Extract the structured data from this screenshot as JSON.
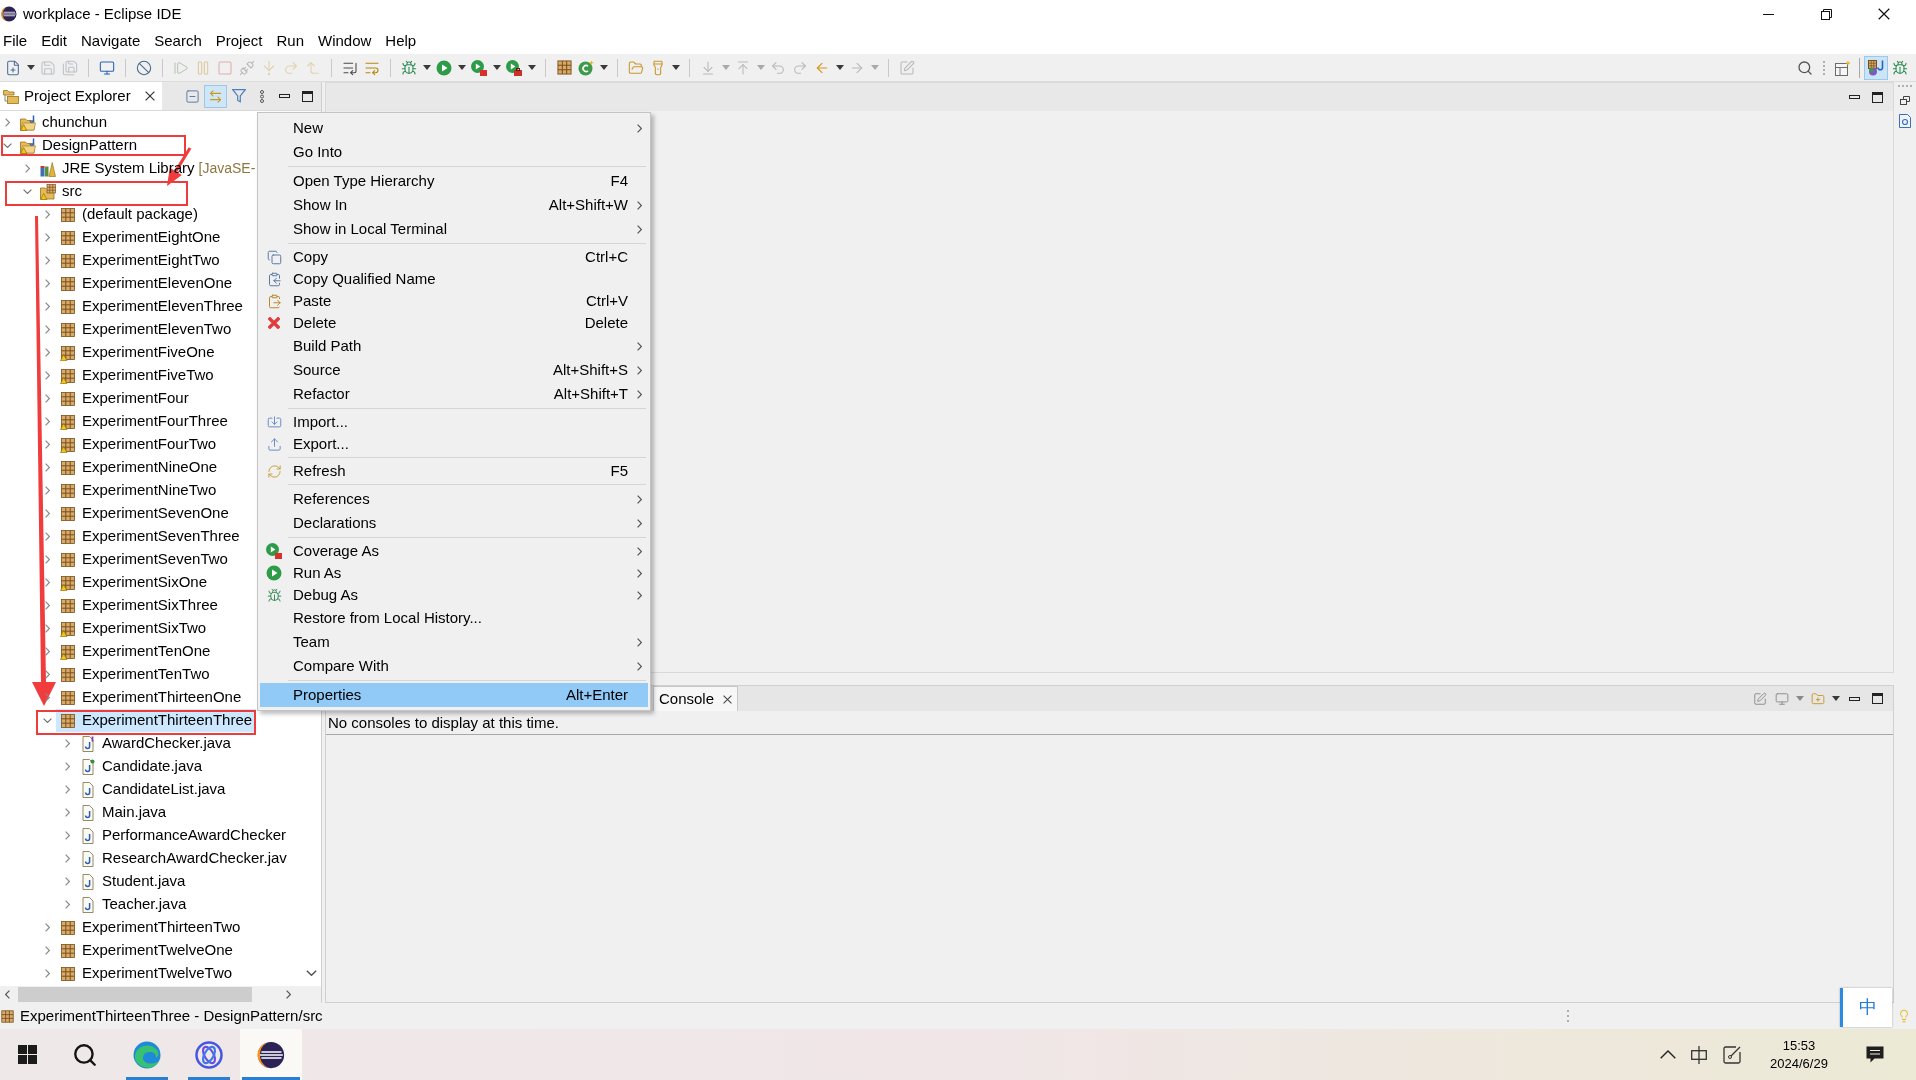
{
  "window": {
    "title": "workplace - Eclipse IDE"
  },
  "menu_bar": [
    "File",
    "Edit",
    "Navigate",
    "Search",
    "Project",
    "Run",
    "Window",
    "Help"
  ],
  "toolbar": [
    [
      {
        "dropdown": true,
        "disabled": false
      },
      {
        "dropdown": false,
        "disabled": true
      },
      {
        "dropdown": false,
        "disabled": true
      }
    ],
    [
      {
        "dropdown": false,
        "disabled": false
      }
    ],
    [
      {
        "dropdown": false,
        "disabled": false
      }
    ],
    [
      {
        "dropdown": false,
        "disabled": true
      },
      {
        "dropdown": false,
        "disabled": true
      },
      {
        "dropdown": false,
        "disabled": true
      },
      {
        "dropdown": false,
        "disabled": true
      },
      {
        "dropdown": false,
        "disabled": true
      },
      {
        "dropdown": false,
        "disabled": true
      },
      {
        "dropdown": false,
        "disabled": true
      }
    ],
    [
      {
        "dropdown": false,
        "disabled": false
      },
      {
        "dropdown": false,
        "disabled": false
      }
    ],
    [
      {
        "dropdown": true,
        "disabled": false
      },
      {
        "dropdown": true,
        "disabled": false
      },
      {
        "dropdown": true,
        "disabled": false
      },
      {
        "dropdown": true,
        "disabled": false
      }
    ],
    [
      {
        "dropdown": false,
        "disabled": false
      },
      {
        "dropdown": true,
        "disabled": false
      }
    ],
    [
      {
        "dropdown": false,
        "disabled": false
      },
      {
        "dropdown": true,
        "disabled": false
      }
    ],
    [
      {
        "dropdown": true,
        "disabled": true
      },
      {
        "dropdown": true,
        "disabled": true
      },
      {
        "dropdown": false,
        "disabled": true
      },
      {
        "dropdown": false,
        "disabled": true
      },
      {
        "dropdown": true,
        "disabled": false
      },
      {
        "dropdown": true,
        "disabled": true
      }
    ],
    [
      {
        "dropdown": false,
        "disabled": true
      }
    ]
  ],
  "perspectives": [
    {
      "selected": true
    },
    {
      "selected": false
    }
  ],
  "project_explorer": {
    "title": "Project Explorer",
    "tools": [
      {
        "on": false
      },
      {
        "on": true
      },
      {
        "on": false
      }
    ],
    "tree": [
      {
        "label": "chunchun",
        "kind": "project",
        "warning": true,
        "expanded": false,
        "selected": false
      },
      {
        "label": "DesignPattern",
        "kind": "project",
        "warning": true,
        "expanded": true,
        "selected": false,
        "children": [
          {
            "label": "JRE System Library",
            "decoration": "[JavaSE-",
            "kind": "library",
            "warning": false,
            "expanded": false,
            "selected": false
          },
          {
            "label": "src",
            "kind": "source",
            "warning": true,
            "expanded": true,
            "selected": false,
            "children": [
              {
                "label": "(default package)",
                "kind": "package",
                "warning": false,
                "expanded": false,
                "selected": false
              },
              {
                "label": "ExperimentEightOne",
                "kind": "package",
                "warning": false,
                "expanded": false,
                "selected": false
              },
              {
                "label": "ExperimentEightTwo",
                "kind": "package",
                "warning": false,
                "expanded": false,
                "selected": false
              },
              {
                "label": "ExperimentElevenOne",
                "kind": "package",
                "warning": false,
                "expanded": false,
                "selected": false
              },
              {
                "label": "ExperimentElevenThree",
                "kind": "package",
                "warning": false,
                "expanded": false,
                "selected": false
              },
              {
                "label": "ExperimentElevenTwo",
                "kind": "package",
                "warning": false,
                "expanded": false,
                "selected": false
              },
              {
                "label": "ExperimentFiveOne",
                "kind": "package",
                "warning": true,
                "expanded": false,
                "selected": false
              },
              {
                "label": "ExperimentFiveTwo",
                "kind": "package",
                "warning": true,
                "expanded": false,
                "selected": false
              },
              {
                "label": "ExperimentFour",
                "kind": "package",
                "warning": false,
                "expanded": false,
                "selected": false
              },
              {
                "label": "ExperimentFourThree",
                "kind": "package",
                "warning": true,
                "expanded": false,
                "selected": false
              },
              {
                "label": "ExperimentFourTwo",
                "kind": "package",
                "warning": true,
                "expanded": false,
                "selected": false
              },
              {
                "label": "ExperimentNineOne",
                "kind": "package",
                "warning": false,
                "expanded": false,
                "selected": false
              },
              {
                "label": "ExperimentNineTwo",
                "kind": "package",
                "warning": false,
                "expanded": false,
                "selected": false
              },
              {
                "label": "ExperimentSevenOne",
                "kind": "package",
                "warning": false,
                "expanded": false,
                "selected": false
              },
              {
                "label": "ExperimentSevenThree",
                "kind": "package",
                "warning": false,
                "expanded": false,
                "selected": false
              },
              {
                "label": "ExperimentSevenTwo",
                "kind": "package",
                "warning": false,
                "expanded": false,
                "selected": false
              },
              {
                "label": "ExperimentSixOne",
                "kind": "package",
                "warning": true,
                "expanded": false,
                "selected": false
              },
              {
                "label": "ExperimentSixThree",
                "kind": "package",
                "warning": false,
                "expanded": false,
                "selected": false
              },
              {
                "label": "ExperimentSixTwo",
                "kind": "package",
                "warning": true,
                "expanded": false,
                "selected": false
              },
              {
                "label": "ExperimentTenOne",
                "kind": "package",
                "warning": true,
                "expanded": false,
                "selected": false
              },
              {
                "label": "ExperimentTenTwo",
                "kind": "package",
                "warning": false,
                "expanded": false,
                "selected": false
              },
              {
                "label": "ExperimentThirteenOne",
                "kind": "package",
                "warning": false,
                "expanded": false,
                "selected": false
              },
              {
                "label": "ExperimentThirteenThree",
                "kind": "package",
                "warning": false,
                "expanded": true,
                "selected": true,
                "children": [
                  {
                    "label": "AwardChecker.java",
                    "kind": "interface",
                    "warning": false,
                    "expanded": false,
                    "selected": false
                  },
                  {
                    "label": "Candidate.java",
                    "kind": "abstract",
                    "warning": false,
                    "expanded": false,
                    "selected": false
                  },
                  {
                    "label": "CandidateList.java",
                    "kind": "file",
                    "warning": false,
                    "expanded": false,
                    "selected": false
                  },
                  {
                    "label": "Main.java",
                    "kind": "file",
                    "warning": false,
                    "expanded": false,
                    "selected": false
                  },
                  {
                    "label": "PerformanceAwardChecker",
                    "kind": "file",
                    "warning": false,
                    "expanded": false,
                    "selected": false
                  },
                  {
                    "label": "ResearchAwardChecker.jav",
                    "kind": "file",
                    "warning": false,
                    "expanded": false,
                    "selected": false
                  },
                  {
                    "label": "Student.java",
                    "kind": "file",
                    "warning": false,
                    "expanded": false,
                    "selected": false
                  },
                  {
                    "label": "Teacher.java",
                    "kind": "file",
                    "warning": false,
                    "expanded": false,
                    "selected": false
                  }
                ]
              },
              {
                "label": "ExperimentThirteenTwo",
                "kind": "package",
                "warning": false,
                "expanded": false,
                "selected": false
              },
              {
                "label": "ExperimentTwelveOne",
                "kind": "package",
                "warning": false,
                "expanded": false,
                "selected": false
              },
              {
                "label": "ExperimentTwelveTwo",
                "kind": "package",
                "warning": false,
                "expanded": false,
                "selected": false
              }
            ]
          }
        ]
      }
    ]
  },
  "context_menu": {
    "groups": [
      [
        {
          "label": "New",
          "submenu": true,
          "selected": false
        },
        {
          "label": "Go Into",
          "submenu": false,
          "selected": false
        }
      ],
      [
        {
          "label": "Open Type Hierarchy",
          "shortcut": "F4",
          "submenu": false,
          "selected": false
        },
        {
          "label": "Show In",
          "shortcut": "Alt+Shift+W",
          "submenu": true,
          "selected": false
        },
        {
          "label": "Show in Local Terminal",
          "submenu": true,
          "selected": false
        }
      ],
      [
        {
          "label": "Copy",
          "shortcut": "Ctrl+C",
          "submenu": false,
          "selected": false
        },
        {
          "label": "Copy Qualified Name",
          "submenu": false,
          "selected": false
        },
        {
          "label": "Paste",
          "shortcut": "Ctrl+V",
          "submenu": false,
          "selected": false
        },
        {
          "label": "Delete",
          "shortcut": "Delete",
          "submenu": false,
          "selected": false
        },
        {
          "label": "Build Path",
          "submenu": true,
          "selected": false
        },
        {
          "label": "Source",
          "shortcut": "Alt+Shift+S",
          "submenu": true,
          "selected": false
        },
        {
          "label": "Refactor",
          "shortcut": "Alt+Shift+T",
          "submenu": true,
          "selected": false
        }
      ],
      [
        {
          "label": "Import...",
          "submenu": false,
          "selected": false
        },
        {
          "label": "Export...",
          "submenu": false,
          "selected": false
        }
      ],
      [
        {
          "label": "Refresh",
          "shortcut": "F5",
          "submenu": false,
          "selected": false
        }
      ],
      [
        {
          "label": "References",
          "submenu": true,
          "selected": false
        },
        {
          "label": "Declarations",
          "submenu": true,
          "selected": false
        }
      ],
      [
        {
          "label": "Coverage As",
          "submenu": true,
          "selected": false
        },
        {
          "label": "Run As",
          "submenu": true,
          "selected": false
        },
        {
          "label": "Debug As",
          "submenu": true,
          "selected": false
        },
        {
          "label": "Restore from Local History...",
          "submenu": false,
          "selected": false
        },
        {
          "label": "Team",
          "submenu": true,
          "selected": false
        },
        {
          "label": "Compare With",
          "submenu": true,
          "selected": false
        }
      ],
      [
        {
          "label": "Properties",
          "shortcut": "Alt+Enter",
          "submenu": false,
          "selected": true
        }
      ]
    ]
  },
  "console": {
    "tab": "Console",
    "message": "No consoles to display at this time."
  },
  "status_bar": {
    "text": "ExperimentThirteenThree - DesignPattern/src"
  },
  "ime": "中",
  "taskbar": {
    "apps": [
      {
        "running": true,
        "selected": false
      },
      {
        "running": true,
        "selected": false
      },
      {
        "running": true,
        "selected": true
      }
    ],
    "time": "15:53",
    "date": "2024/6/29"
  }
}
